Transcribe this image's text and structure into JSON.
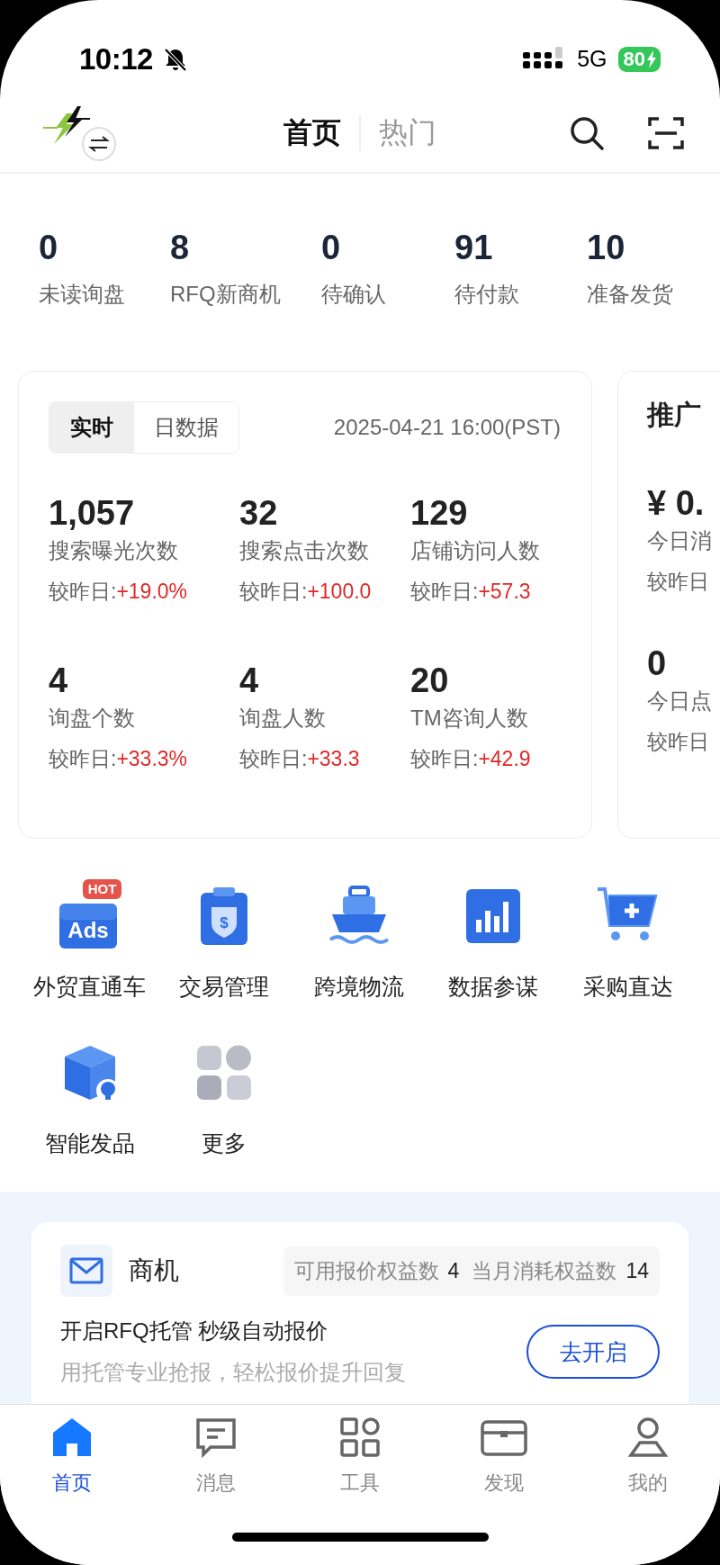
{
  "status_bar": {
    "time": "10:12",
    "network": "5G",
    "battery": "80"
  },
  "header": {
    "tabs": [
      {
        "label": "首页",
        "selected": true
      },
      {
        "label": "热门",
        "selected": false
      }
    ]
  },
  "summary": [
    {
      "value": "0",
      "label": "未读询盘"
    },
    {
      "value": "8",
      "label": "RFQ新商机"
    },
    {
      "value": "0",
      "label": "待确认"
    },
    {
      "value": "91",
      "label": "待付款"
    },
    {
      "value": "10",
      "label": "准备发货"
    }
  ],
  "realtime_card": {
    "segments": [
      {
        "label": "实时",
        "selected": true
      },
      {
        "label": "日数据",
        "selected": false
      }
    ],
    "timestamp": "2025-04-21 16:00(PST)",
    "metrics": [
      {
        "value": "1,057",
        "label": "搜索曝光次数",
        "change_label": "较昨日:",
        "change": "+19.0%"
      },
      {
        "value": "32",
        "label": "搜索点击次数",
        "change_label": "较昨日:",
        "change": "+100.0"
      },
      {
        "value": "129",
        "label": "店铺访问人数",
        "change_label": "较昨日:",
        "change": "+57.3"
      },
      {
        "value": "4",
        "label": "询盘个数",
        "change_label": "较昨日:",
        "change": "+33.3%"
      },
      {
        "value": "4",
        "label": "询盘人数",
        "change_label": "较昨日:",
        "change": "+33.3"
      },
      {
        "value": "20",
        "label": "TM咨询人数",
        "change_label": "较昨日:",
        "change": "+42.9"
      }
    ]
  },
  "promo_card": {
    "title": "推广",
    "metrics": [
      {
        "value": "¥ 0.",
        "label": "今日消",
        "change_label": "较昨日"
      },
      {
        "value": "0",
        "label": "今日点",
        "change_label": "较昨日"
      }
    ]
  },
  "tools": [
    {
      "label": "外贸直通车",
      "kind": "ads",
      "icon_text": "Ads",
      "badge": "HOT"
    },
    {
      "label": "交易管理",
      "kind": "clipboard",
      "icon_text": "$"
    },
    {
      "label": "跨境物流",
      "kind": "ship"
    },
    {
      "label": "数据参谋",
      "kind": "chart"
    },
    {
      "label": "采购直达",
      "kind": "cart"
    },
    {
      "label": "智能发品",
      "kind": "cube"
    },
    {
      "label": "更多",
      "kind": "more"
    }
  ],
  "opportunities": {
    "title": "商机",
    "quota": [
      {
        "label": "可用报价权益数",
        "value": "4"
      },
      {
        "label": "当月消耗权益数",
        "value": "14"
      }
    ],
    "headline": "开启RFQ托管 秒级自动报价",
    "subtitle": "用托管专业抢报，轻松报价提升回复",
    "button": "去开启"
  },
  "tab_bar": [
    {
      "label": "首页",
      "kind": "home",
      "selected": true
    },
    {
      "label": "消息",
      "kind": "message",
      "selected": false
    },
    {
      "label": "工具",
      "kind": "tools",
      "selected": false
    },
    {
      "label": "发现",
      "kind": "box",
      "selected": false
    },
    {
      "label": "我的",
      "kind": "person",
      "selected": false
    }
  ]
}
